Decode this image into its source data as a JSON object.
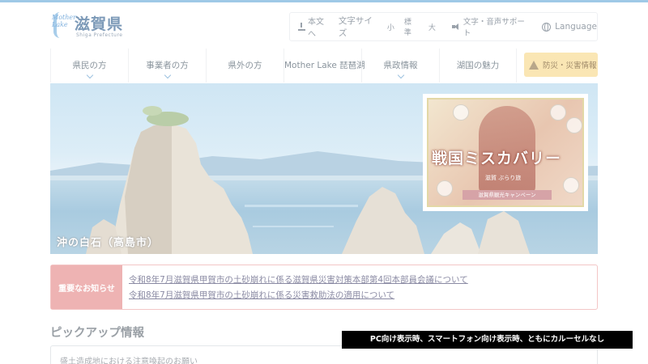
{
  "header": {
    "logo": {
      "tagline": "Mother Lake",
      "name_ja": "滋賀県",
      "name_en": "Shiga Prefecture"
    },
    "utility": {
      "skip_label": "本文へ",
      "font_size_label": "文字サイズ",
      "size_small": "小",
      "size_standard": "標準",
      "size_large": "大",
      "voice_label": "文字・音声サポート",
      "language_label": "Language"
    }
  },
  "nav": {
    "items": [
      {
        "label": "県民の方",
        "has_submenu": true
      },
      {
        "label": "事業者の方",
        "has_submenu": true
      },
      {
        "label": "県外の方",
        "has_submenu": false
      },
      {
        "label": "Mother Lake 琵琶湖",
        "has_submenu": false
      },
      {
        "label": "県政情報",
        "has_submenu": true
      },
      {
        "label": "湖国の魅力",
        "has_submenu": false
      }
    ],
    "disaster_label": "防災・災害情報"
  },
  "hero": {
    "caption": "沖の白石（高島市）",
    "banner": {
      "title": "戦国ミスカバリー",
      "subtitle": "滋賀 ぶらり旅",
      "campaign": "滋賀県観光キャンペーン"
    }
  },
  "notice": {
    "label": "重要なお知らせ",
    "items": [
      "令和8年7月滋賀県甲賀市の土砂崩れに係る滋賀県災害対策本部第4回本部員会議について",
      "令和8年7月滋賀県甲賀市の土砂崩れに係る災害救助法の適用について"
    ]
  },
  "pickup": {
    "title": "ピックアップ情報",
    "items": [
      "盛土造成地における注意喚起のお願い"
    ]
  },
  "overlay_caption": "PC向け表示時、スマートフォン向け表示時、ともにカルーセルなし",
  "colors": {
    "accent_blue": "#9dc2e0",
    "notice_pink": "#eeb3b3",
    "disaster_yellow": "#fae6b4"
  }
}
